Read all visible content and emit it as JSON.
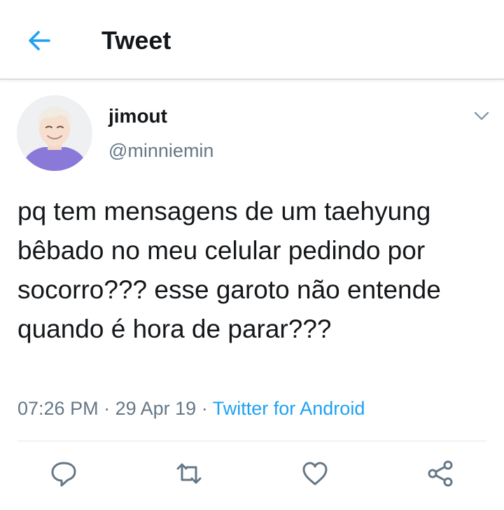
{
  "header": {
    "title": "Tweet",
    "back_icon": "back-arrow-icon",
    "accent_color": "#1da1f2"
  },
  "tweet": {
    "author": {
      "display_name": "jimout",
      "handle": "@minniemin",
      "avatar_icon": "user-avatar"
    },
    "text": "pq tem mensagens de um taehyung bêbado no meu celular pedindo por socorro??? esse garoto não entende quando é hora de parar???",
    "time": "07:26 PM",
    "date": "29 Apr 19",
    "separator": "·",
    "source": "Twitter for Android",
    "caret_icon": "chevron-down-icon"
  },
  "actions": [
    {
      "name": "reply",
      "icon": "reply-icon"
    },
    {
      "name": "retweet",
      "icon": "retweet-icon"
    },
    {
      "name": "like",
      "icon": "heart-icon"
    },
    {
      "name": "share",
      "icon": "share-icon"
    }
  ],
  "colors": {
    "text_primary": "#14171a",
    "text_secondary": "#657786",
    "link": "#1da1f2",
    "divider": "#e1e8ed"
  }
}
